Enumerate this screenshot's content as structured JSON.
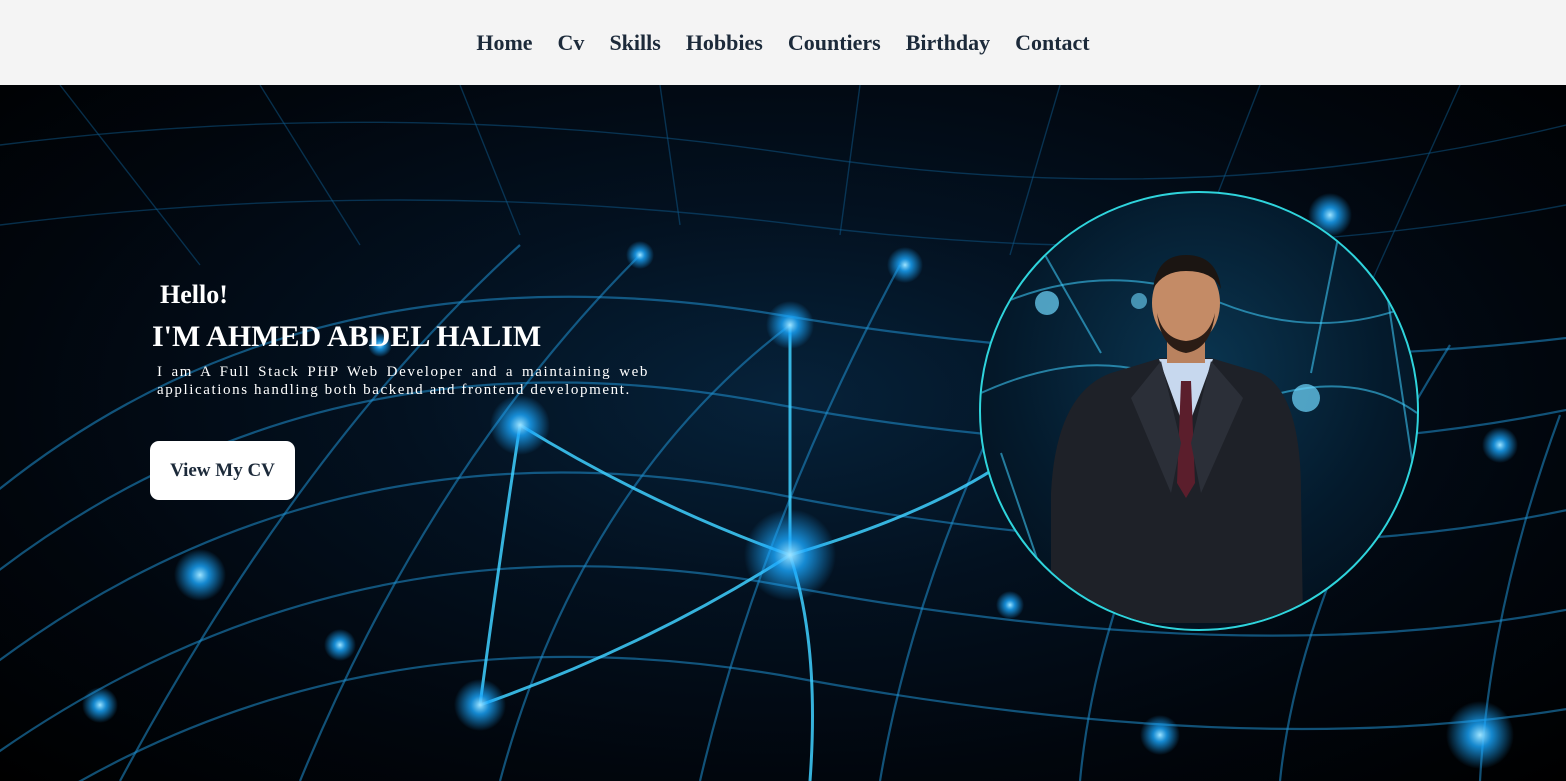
{
  "nav": {
    "items": [
      {
        "label": "Home"
      },
      {
        "label": "Cv"
      },
      {
        "label": "Skills"
      },
      {
        "label": "Hobbies"
      },
      {
        "label": "Countiers"
      },
      {
        "label": "Birthday"
      },
      {
        "label": "Contact"
      }
    ]
  },
  "hero": {
    "greeting": "Hello!",
    "name": "I'M AHMED ABDEL HALIM",
    "description": "I am A Full Stack PHP Web Developer and a maintaining web applications handling both backend and frontend development.",
    "cta_label": "View My CV"
  },
  "colors": {
    "nav_background": "#f4f4f4",
    "nav_text": "#1c2a3a",
    "accent_ring": "#2fd4dc",
    "network_glow": "#1aa8ff"
  }
}
